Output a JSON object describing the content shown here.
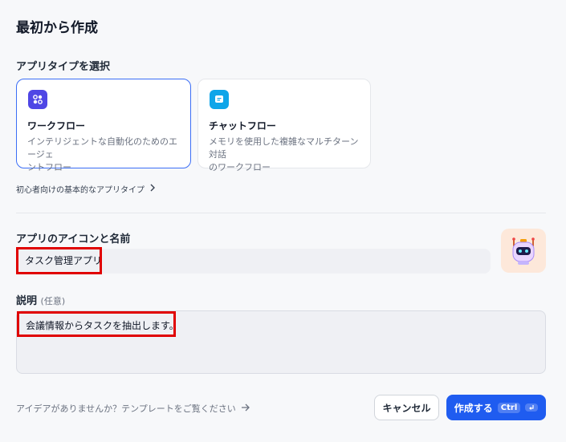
{
  "header": {
    "title": "最初から作成"
  },
  "app_type": {
    "label": "アプリタイプを選択",
    "options": [
      {
        "name": "ワークフロー",
        "desc_line1": "インテリジェントな自動化のためのエージェ",
        "desc_line2": "ントフロー",
        "selected": true,
        "icon": "workflow-icon",
        "icon_color": "#4f46e5"
      },
      {
        "name": "チャットフロー",
        "desc_line1": "メモリを使用した複雑なマルチターン対話",
        "desc_line2": "のワークフロー",
        "selected": false,
        "icon": "chatflow-icon",
        "icon_color": "#0ea5e9"
      }
    ],
    "basic_link": "初心者向けの基本的なアプリタイプ"
  },
  "app_name": {
    "label": "アプリのアイコンと名前",
    "value": "タスク管理アプリ",
    "icon": "robot-icon"
  },
  "description": {
    "label": "説明",
    "optional": "(任意)",
    "value": "会議情報からタスクを抽出します。"
  },
  "footer": {
    "idea_link": "アイデアがありませんか？テンプレートをご覧ください",
    "cancel_label": "キャンセル",
    "create_label": "作成する",
    "shortcut_label": "Ctrl",
    "accent_color": "#1f5cf0"
  }
}
